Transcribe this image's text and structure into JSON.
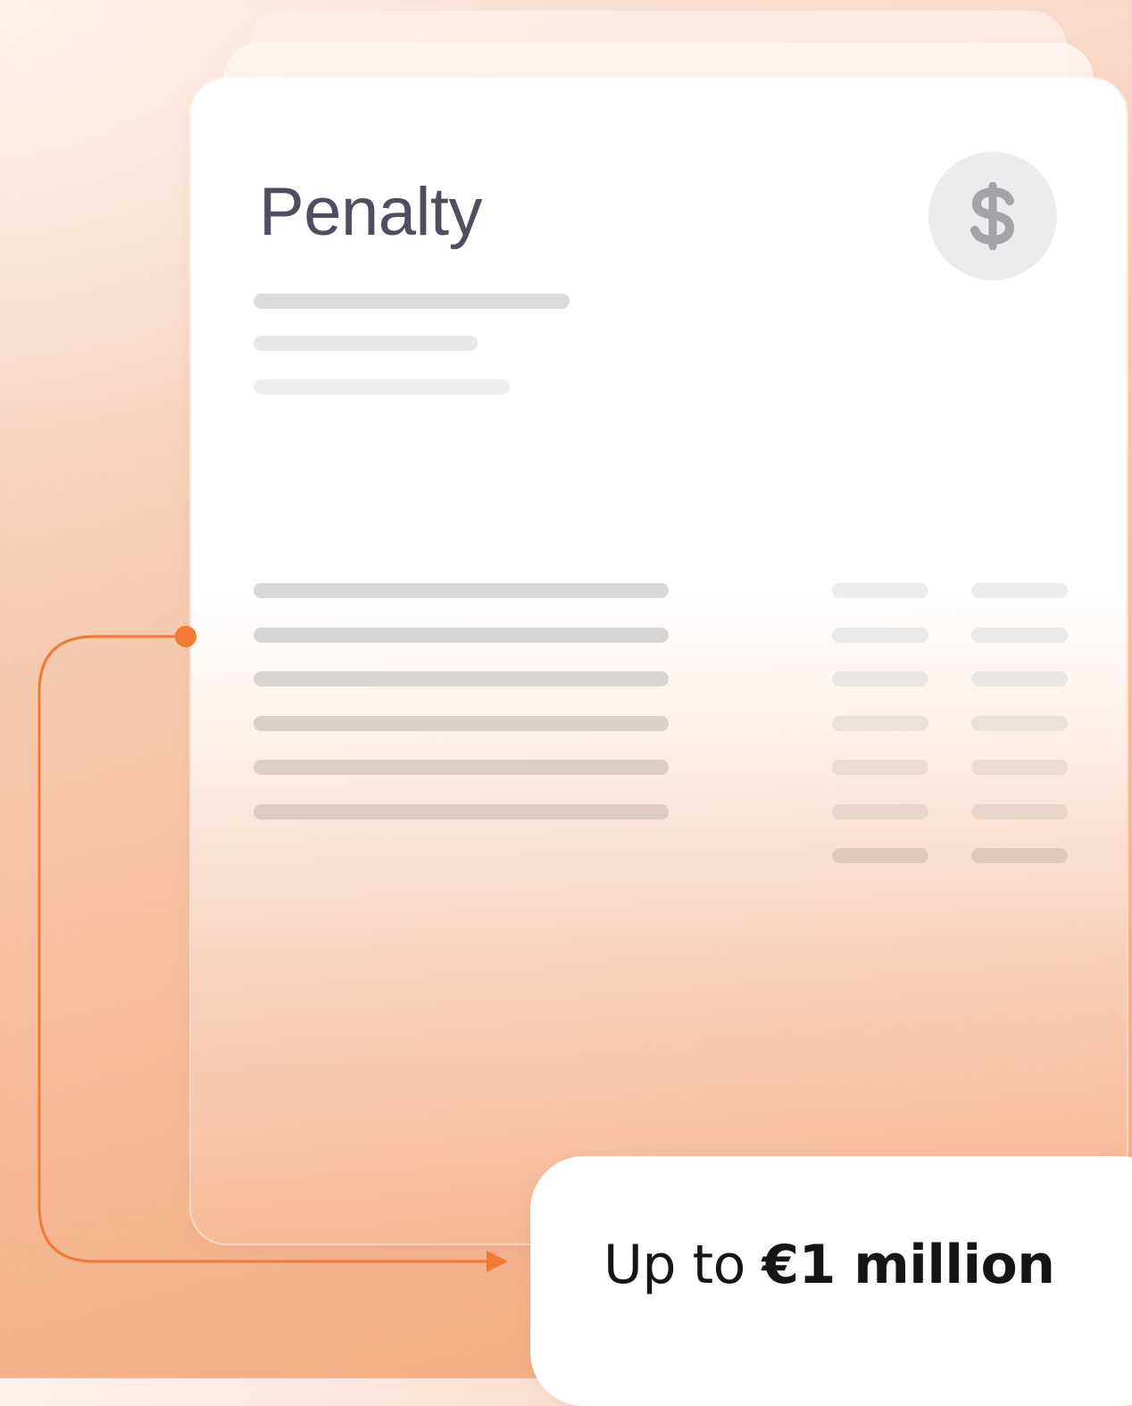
{
  "card": {
    "title": "Penalty",
    "badge_icon": "dollar-icon"
  },
  "callout": {
    "prefix": "Up to ",
    "amount": "€1 million"
  },
  "colors": {
    "accent": "#f07a32",
    "title": "#4d4f60",
    "placeholder_bar": "#d9d9d9",
    "coin_background": "#ececee",
    "coin_icon": "#a3a3aa"
  }
}
